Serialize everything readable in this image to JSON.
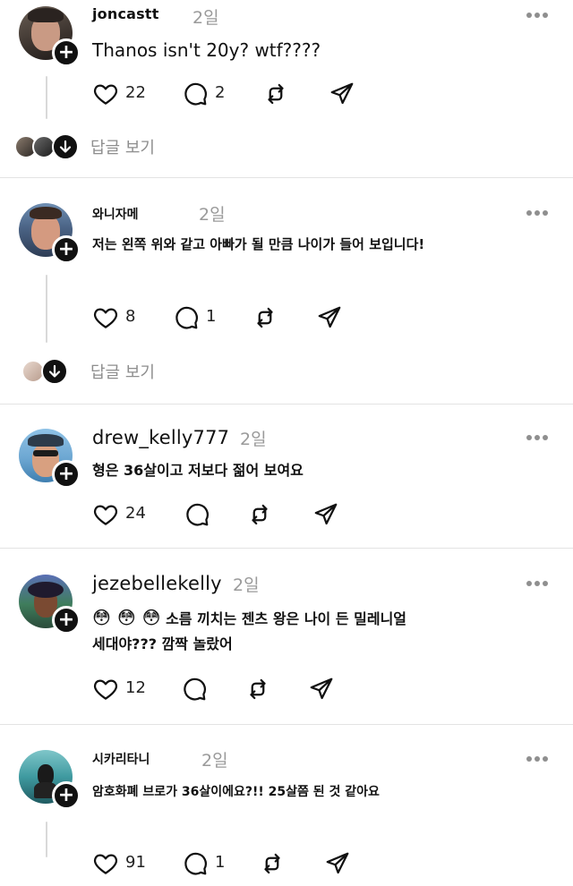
{
  "posts": [
    {
      "username": "joncastt",
      "time": "2일",
      "text": "Thanos isn't 20y? wtf????",
      "likes": "22",
      "comments": "2",
      "view_replies": "답글 보기"
    },
    {
      "username": "와니자메",
      "time": "2일",
      "text": "저는 왼쪽 위와 같고 아빠가 될 만큼 나이가 들어 보입니다!",
      "likes": "8",
      "comments": "1",
      "view_replies": "답글 보기"
    },
    {
      "username": "drew_kelly777",
      "time": "2일",
      "text": "형은 36살이고 저보다 젊어 보여요",
      "likes": "24",
      "comments": ""
    },
    {
      "username": "jezebellekelly",
      "time": "2일",
      "emoji": "😳 😳 😳",
      "text_line1": "소름 끼치는 젠츠 왕은 나이 든 밀레니얼",
      "text_line2": "세대야??? 깜짝 놀랐어",
      "likes": "12",
      "comments": ""
    },
    {
      "username": "시카리타니",
      "time": "2일",
      "text": "암호화폐 브로가 36살이에요?!! 25살쯤 된 것 같아요",
      "likes": "91",
      "comments": "1"
    }
  ],
  "icons": {
    "like": "heart-icon",
    "comment": "comment-bubble-icon",
    "repost": "repost-arrows-icon",
    "share": "send-paper-plane-icon",
    "more": "more-dots-icon",
    "follow": "plus-icon",
    "expand": "arrow-down-icon"
  }
}
